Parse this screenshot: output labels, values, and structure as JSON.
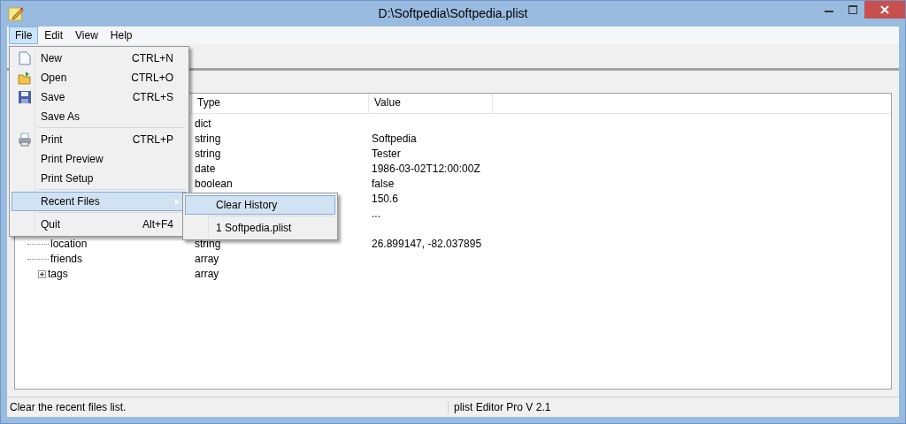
{
  "window": {
    "title": "D:\\Softpedia\\Softpedia.plist"
  },
  "menubar": [
    {
      "label": "File",
      "selected": true
    },
    {
      "label": "Edit",
      "selected": false
    },
    {
      "label": "View",
      "selected": false
    },
    {
      "label": "Help",
      "selected": false
    }
  ],
  "table": {
    "columns": [
      "Type",
      "Value"
    ],
    "rows": [
      {
        "type": "dict"
      },
      {
        "type": "string",
        "value": "Softpedia"
      },
      {
        "type": "string",
        "value": "Tester"
      },
      {
        "type": "date",
        "value": "1986-03-02T12:00:00Z"
      },
      {
        "type": "boolean",
        "value": "false"
      },
      {
        "value": "150.6"
      },
      {
        "value": "..."
      },
      {},
      {
        "key": "location",
        "type": "string",
        "value": "26.899147, -82.037895"
      },
      {
        "key": "friends",
        "type": "array"
      },
      {
        "key": "tags",
        "type": "array",
        "expandable": true
      }
    ]
  },
  "file_menu": {
    "items": [
      {
        "kind": "item",
        "label": "New",
        "shortcut": "CTRL+N"
      },
      {
        "kind": "item",
        "label": "Open",
        "shortcut": "CTRL+O"
      },
      {
        "kind": "item",
        "label": "Save",
        "shortcut": "CTRL+S"
      },
      {
        "kind": "item",
        "label": "Save As"
      },
      {
        "kind": "separator"
      },
      {
        "kind": "item",
        "label": "Print",
        "shortcut": "CTRL+P"
      },
      {
        "kind": "item",
        "label": "Print Preview"
      },
      {
        "kind": "item",
        "label": "Print Setup"
      },
      {
        "kind": "separator"
      },
      {
        "kind": "submenu",
        "label": "Recent Files",
        "selected": true
      },
      {
        "kind": "separator"
      },
      {
        "kind": "item",
        "label": "Quit",
        "shortcut": "Alt+F4"
      }
    ]
  },
  "recent_submenu": {
    "items": [
      {
        "kind": "item",
        "label": "Clear History",
        "selected": true
      },
      {
        "kind": "separator"
      },
      {
        "kind": "item",
        "label": "1 Softpedia.plist",
        "selected": false
      }
    ]
  },
  "status_bar": {
    "message": "Clear the recent files list.",
    "version": "plist Editor Pro V 2.1"
  }
}
